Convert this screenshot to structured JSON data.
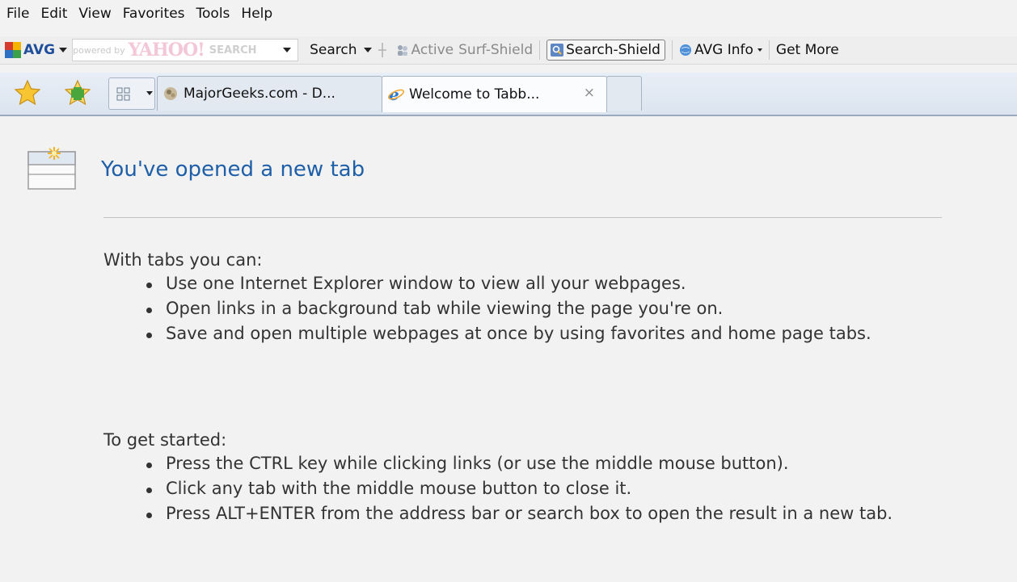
{
  "menu": [
    "File",
    "Edit",
    "View",
    "Favorites",
    "Tools",
    "Help"
  ],
  "toolbar": {
    "avg_label": "AVG",
    "yahoo_powered": "powered by",
    "yahoo_brand": "YAHOO!",
    "yahoo_search": "SEARCH",
    "search_label": "Search",
    "active_label": "Active",
    "surf_shield_label": "Surf-Shield",
    "search_shield_label": "Search-Shield",
    "avg_info_label": "AVG Info",
    "get_more_label": "Get More"
  },
  "tabs": [
    {
      "label": "MajorGeeks.com - D...",
      "active": false
    },
    {
      "label": "Welcome to Tabb...",
      "active": true,
      "close": "×"
    }
  ],
  "page": {
    "title": "You've opened a new tab",
    "section1": {
      "heading": "With tabs you can:",
      "items": [
        "Use one Internet Explorer window to view all your webpages.",
        "Open links in a background tab while viewing the page you're on.",
        "Save and open multiple webpages at once by using favorites and home page tabs."
      ]
    },
    "section2": {
      "heading": "To get started:",
      "items": [
        "Press the CTRL key while clicking links (or use the middle mouse button).",
        "Click any tab with the middle mouse button to close it.",
        "Press ALT+ENTER from the address bar or search box to open the result in a new tab."
      ]
    }
  },
  "colors": {
    "title_blue": "#1f5fa8",
    "body_text": "#333333",
    "background": "#f2f2f2"
  }
}
